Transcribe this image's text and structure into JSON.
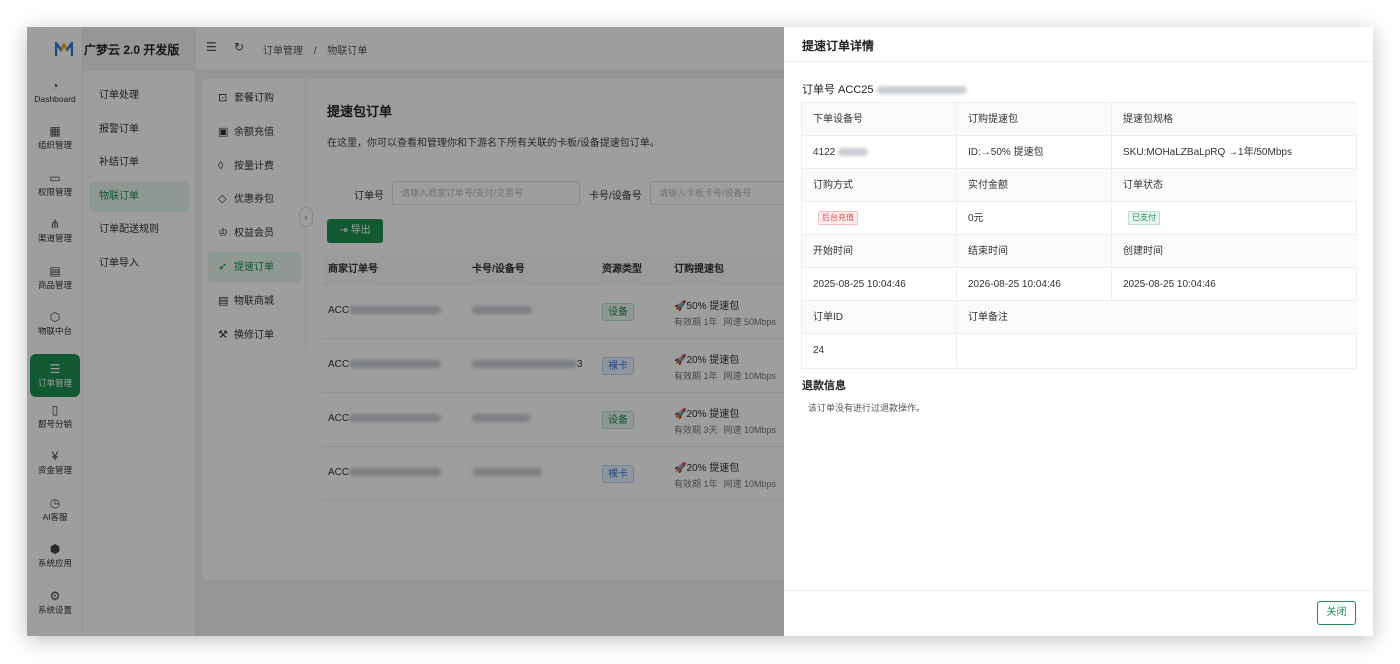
{
  "app": {
    "logo_text": "广梦云 2.0 开发版"
  },
  "rail": [
    {
      "label": "Dashboard",
      "icon": "dashboard-icon",
      "glyph": "◔"
    },
    {
      "label": "组织管理",
      "icon": "grid-icon",
      "glyph": "▦"
    },
    {
      "label": "权限管理",
      "icon": "monitor-icon",
      "glyph": "▭"
    },
    {
      "label": "渠道管理",
      "icon": "network-icon",
      "glyph": "⋔"
    },
    {
      "label": "商品管理",
      "icon": "shop-icon",
      "glyph": "▤"
    },
    {
      "label": "物联中台",
      "icon": "cube-icon",
      "glyph": "⬡"
    },
    {
      "label": "订单管理",
      "icon": "list-icon",
      "glyph": "☰"
    },
    {
      "label": "靓号分销",
      "icon": "phone-icon",
      "glyph": "▯"
    },
    {
      "label": "资金管理",
      "icon": "wallet-icon",
      "glyph": "¥"
    },
    {
      "label": "AI客服",
      "icon": "clock-icon",
      "glyph": "◷"
    },
    {
      "label": "系统应用",
      "icon": "app-icon",
      "glyph": "⬢"
    },
    {
      "label": "系统设置",
      "icon": "gear-icon",
      "glyph": "⚙"
    }
  ],
  "subnav": [
    "订单处理",
    "报警订单",
    "补结订单",
    "物联订单",
    "订单配送规则",
    "订单导入"
  ],
  "breadcrumb": [
    "订单管理",
    "/",
    "物联订单"
  ],
  "menu2": [
    {
      "label": "套餐订购",
      "icon": "cart-icon",
      "glyph": "⊡"
    },
    {
      "label": "余额充值",
      "icon": "wallet-icon",
      "glyph": "▣"
    },
    {
      "label": "按量计费",
      "icon": "drop-icon",
      "glyph": "◊"
    },
    {
      "label": "优惠券包",
      "icon": "tag-icon",
      "glyph": "◇"
    },
    {
      "label": "权益会员",
      "icon": "crown-icon",
      "glyph": "♔"
    },
    {
      "label": "提速订单",
      "icon": "rocket-icon",
      "glyph": "➶"
    },
    {
      "label": "物联商城",
      "icon": "doc-icon",
      "glyph": "▤"
    },
    {
      "label": "换修订单",
      "icon": "hammer-icon",
      "glyph": "⚒"
    }
  ],
  "page": {
    "title": "提速包订单",
    "desc": "在这里，你可以查看和管理你和下游名下所有关联的卡板/设备提速包订单。",
    "filter_order_label": "订单号",
    "filter_order_placeholder": "请输入商家订单号/支付/交易号",
    "filter_card_label": "卡号/设备号",
    "filter_card_placeholder": "请输入卡板卡号/设备号",
    "export_label": "导出"
  },
  "table": {
    "headers": [
      "商家订单号",
      "卡号/设备号",
      "资源类型",
      "订购提速包"
    ],
    "rows": [
      {
        "order_prefix": "ACC",
        "card_suffix": "",
        "type": "设备",
        "type_kind": "dev",
        "pkg": "🚀50% 提速包",
        "validity": "有效期 1年",
        "speed": "网速 50Mbps"
      },
      {
        "order_prefix": "ACC",
        "card_suffix": "3",
        "type": "裸卡",
        "type_kind": "card",
        "pkg": "🚀20% 提速包",
        "validity": "有效期 1年",
        "speed": "网速 10Mbps"
      },
      {
        "order_prefix": "ACC",
        "card_suffix": "",
        "type": "设备",
        "type_kind": "dev",
        "pkg": "🚀20% 提速包",
        "validity": "有效期 3天",
        "speed": "网速 10Mbps"
      },
      {
        "order_prefix": "ACC",
        "card_suffix": "",
        "type": "裸卡",
        "type_kind": "card",
        "pkg": "🚀20% 提速包",
        "validity": "有效期 1年",
        "speed": "网速 10Mbps"
      }
    ]
  },
  "drawer": {
    "title": "提速订单详情",
    "order_label": "订单号 ACC25",
    "cells": {
      "device_no_label": "下单设备号",
      "device_no_value": "4122",
      "pkg_label": "订购提速包",
      "pkg_value": "ID:→50% 提速包",
      "spec_label": "提速包规格",
      "spec_value": "SKU:MOHaLZBaLpRQ →1年/50Mbps",
      "method_label": "订购方式",
      "method_value": "后台充值",
      "amount_label": "实付金额",
      "amount_value": "0元",
      "status_label": "订单状态",
      "status_value": "已支付",
      "start_label": "开始时间",
      "start_value": "2025-08-25 10:04:46",
      "end_label": "结束时间",
      "end_value": "2026-08-25 10:04:46",
      "created_label": "创建时间",
      "created_value": "2025-08-25 10:04:46",
      "id_label": "订单ID",
      "id_value": "24",
      "remark_label": "订单备注",
      "remark_value": ""
    },
    "refund_title": "退款信息",
    "refund_text": "该订单没有进行过退款操作。",
    "close_label": "关闭"
  }
}
